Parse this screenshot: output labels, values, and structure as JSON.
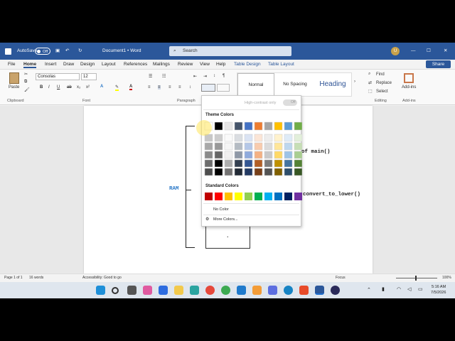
{
  "title_bar": {
    "autosave_label": "AutoSave",
    "autosave_state": "Off",
    "doc_title": "Document1 • Word",
    "search_placeholder": "Search",
    "user_initial": "U"
  },
  "menu": [
    "File",
    "Home",
    "Insert",
    "Draw",
    "Design",
    "Layout",
    "References",
    "Mailings",
    "Review",
    "View",
    "Help",
    "Table Design",
    "Table Layout"
  ],
  "share_label": "Share",
  "ribbon": {
    "paste_label": "Paste",
    "font_name": "Consolas",
    "font_size": "12",
    "styles": [
      "Normal",
      "No Spacing",
      "Heading"
    ],
    "find_label": "Find",
    "replace_label": "Replace",
    "select_label": "Select",
    "addins_label": "Add-ins",
    "groups": [
      "Clipboard",
      "Font",
      "Paragraph",
      "Editing",
      "Add-ins"
    ]
  },
  "document": {
    "ram_label": "RAM",
    "code_line1": "of main()",
    "code_line2": "convert_to_lower()",
    "dot1": ".",
    "dot2": "."
  },
  "dropdown": {
    "high_contrast_label": "High-contrast only",
    "toggle_state": "Off",
    "theme_colors_label": "Theme Colors",
    "standard_colors_label": "Standard Colors",
    "no_color_label": "No Color",
    "more_colors_label": "More Colors...",
    "theme_top": [
      "#ffffff",
      "#000000",
      "#e7e6e6",
      "#44546a",
      "#4472c4",
      "#ed7d31",
      "#a5a5a5",
      "#ffc000",
      "#5b9bd5",
      "#70ad47"
    ],
    "standard": [
      "#c00000",
      "#ff0000",
      "#ffc000",
      "#ffff00",
      "#92d050",
      "#00b050",
      "#00b0f0",
      "#0070c0",
      "#002060",
      "#7030a0"
    ]
  },
  "status": {
    "page": "Page 1 of 1",
    "words": "16 words",
    "accessibility": "Accessibility: Good to go",
    "focus": "Focus",
    "zoom": "100%"
  },
  "clock": {
    "time": "5:16 AM",
    "date": "7/5/2026"
  }
}
